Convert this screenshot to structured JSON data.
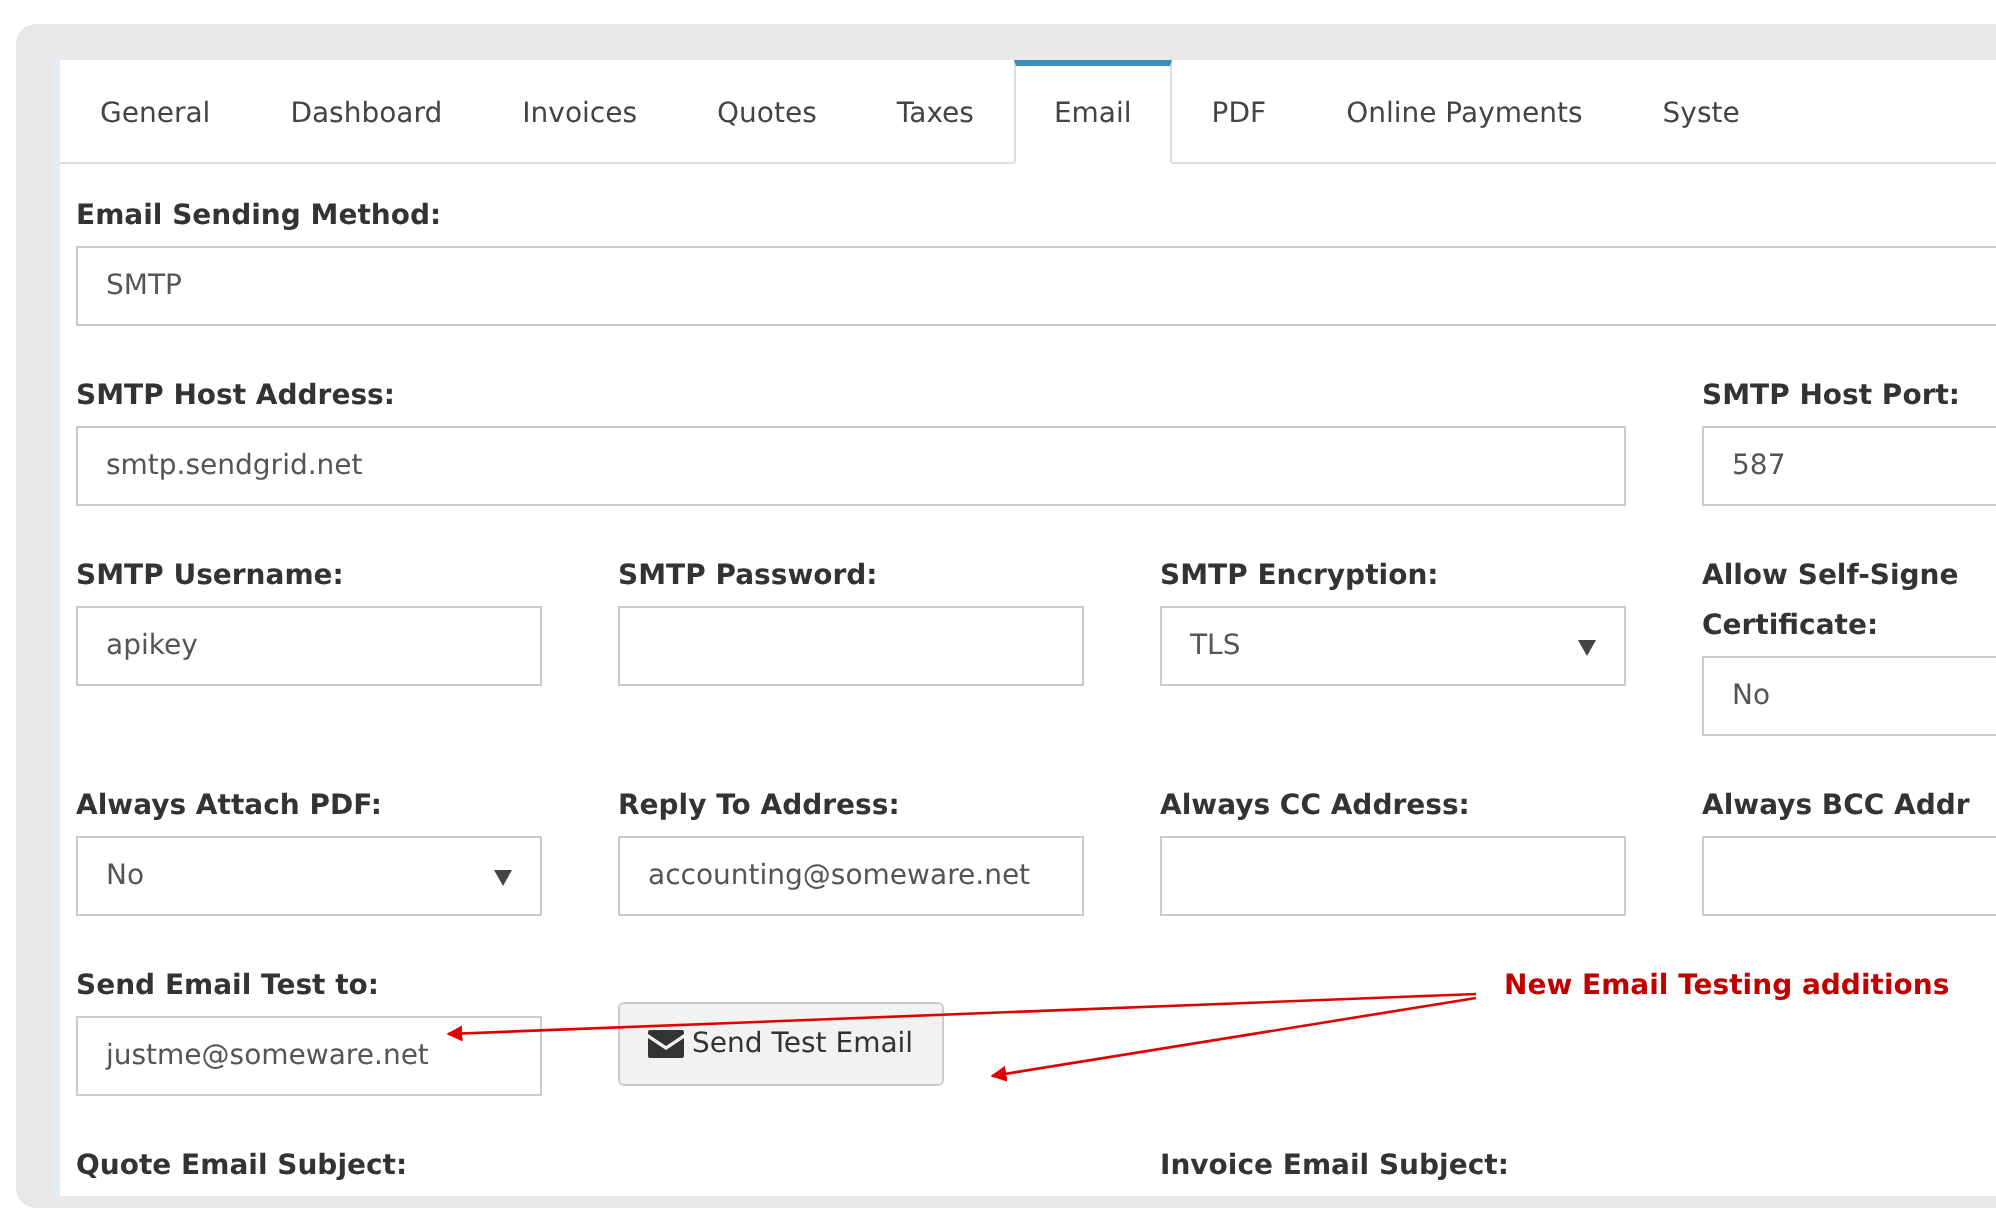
{
  "tabs": [
    {
      "label": "General",
      "selected": false
    },
    {
      "label": "Dashboard",
      "selected": false
    },
    {
      "label": "Invoices",
      "selected": false
    },
    {
      "label": "Quotes",
      "selected": false
    },
    {
      "label": "Taxes",
      "selected": false
    },
    {
      "label": "Email",
      "selected": true
    },
    {
      "label": "PDF",
      "selected": false
    },
    {
      "label": "Online Payments",
      "selected": false
    },
    {
      "label": "Syste",
      "selected": false
    }
  ],
  "rows": [
    [
      {
        "kind": "input",
        "label": "Email Sending Method:",
        "value": "SMTP"
      }
    ],
    [
      {
        "kind": "input",
        "label": "SMTP Host Address:",
        "value": "smtp.sendgrid.net"
      },
      {
        "kind": "input",
        "label": "SMTP Host Port:",
        "value": "587"
      }
    ],
    [
      {
        "kind": "input",
        "label": "SMTP Username:",
        "value": "apikey"
      },
      {
        "kind": "input",
        "label": "SMTP Password:"
      },
      {
        "kind": "select",
        "label": "SMTP Encryption:",
        "value": "TLS"
      },
      {
        "kind": "input",
        "label": "Allow Self-Signe",
        "label_line_2": "Certificate:",
        "value": "No"
      }
    ],
    [
      {
        "kind": "select",
        "label": "Always Attach PDF:",
        "value": "No"
      },
      {
        "kind": "input",
        "label": "Reply To Address:",
        "value": "accounting@someware.net"
      },
      {
        "kind": "input",
        "label": "Always CC Address:"
      },
      {
        "kind": "input",
        "label": "Always BCC Addr"
      }
    ],
    [
      {
        "kind": "input",
        "label": "Send Email Test to:",
        "value": "justme@someware.net"
      },
      {
        "kind": "button",
        "label": "Send Test Email"
      }
    ],
    [
      {
        "kind": "label",
        "label": "Quote Email Subject:"
      },
      {
        "kind": "blank"
      },
      {
        "kind": "label",
        "label": "Invoice Email Subject:"
      }
    ]
  ],
  "annotation": {
    "text": "New Email Testing additions"
  }
}
